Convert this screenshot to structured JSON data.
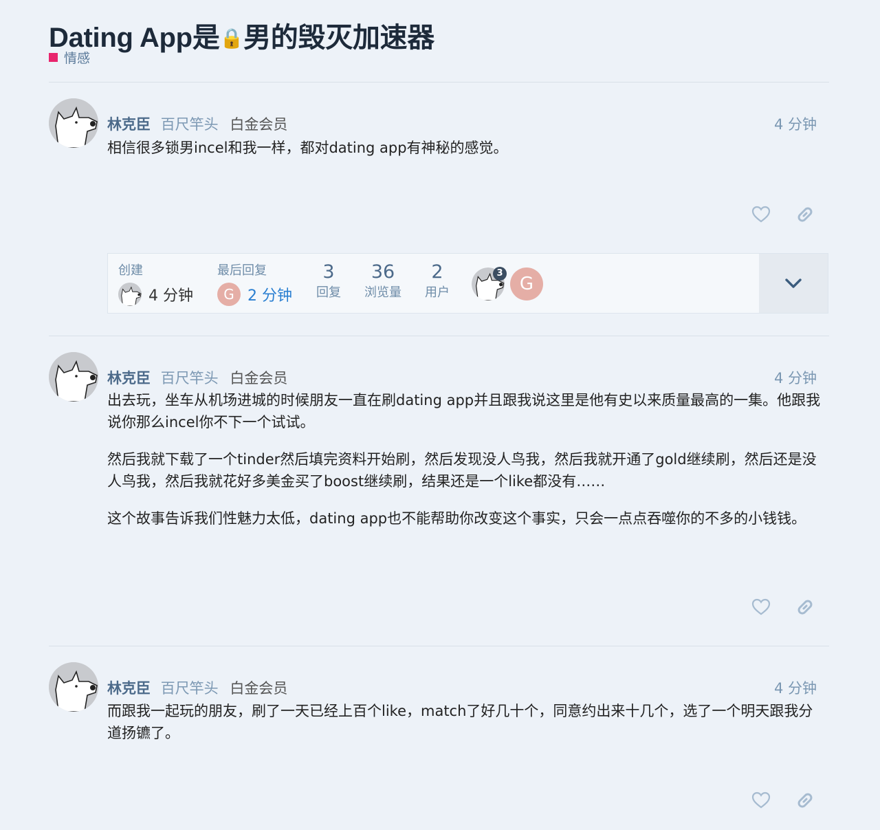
{
  "topic": {
    "title_pre": "Dating App是",
    "title_post": "男的毁灭加速器",
    "category": "情感",
    "category_color": "#e8256d"
  },
  "posts": [
    {
      "username": "林克臣",
      "user_title": "百尺竿头",
      "group": "白金会员",
      "time": "4 分钟",
      "paragraphs": [
        "相信很多锁男incel和我一样，都对dating app有神秘的感觉。"
      ]
    },
    {
      "username": "林克臣",
      "user_title": "百尺竿头",
      "group": "白金会员",
      "time": "4 分钟",
      "paragraphs": [
        "出去玩，坐车从机场进城的时候朋友一直在刷dating app并且跟我说这里是他有史以来质量最高的一集。他跟我说你那么incel你不下一个试试。",
        "然后我就下载了一个tinder然后填完资料开始刷，然后发现没人鸟我，然后我就开通了gold继续刷，然后还是没人鸟我，然后我就花好多美金买了boost继续刷，结果还是一个like都没有……",
        "这个故事告诉我们性魅力太低，dating app也不能帮助你改变这个事实，只会一点点吞噬你的不多的小钱钱。"
      ]
    },
    {
      "username": "林克臣",
      "user_title": "百尺竿头",
      "group": "白金会员",
      "time": "4 分钟",
      "paragraphs": [
        "而跟我一起玩的朋友，刷了一天已经上百个like，match了好几十个，同意约出来十几个，选了一个明天跟我分道扬镳了。"
      ]
    }
  ],
  "topic_map": {
    "created_label": "创建",
    "created_time": "4 分钟",
    "last_reply_label": "最后回复",
    "last_reply_avatar_letter": "G",
    "last_reply_time": "2 分钟",
    "replies_count": "3",
    "replies_label": "回复",
    "views_count": "36",
    "views_label": "浏览量",
    "users_count": "2",
    "users_label": "用户",
    "participant_post_count": "3",
    "participant2_letter": "G"
  },
  "colors": {
    "background": "#edf2f8",
    "link_time_blue": "#2a7fd1",
    "username": "#4c6a8a",
    "g_avatar": "#e5aea6"
  },
  "icons": {
    "like": "heart-outline-icon",
    "share": "link-icon",
    "expand": "chevron-down-icon",
    "lock": "lock-icon"
  }
}
